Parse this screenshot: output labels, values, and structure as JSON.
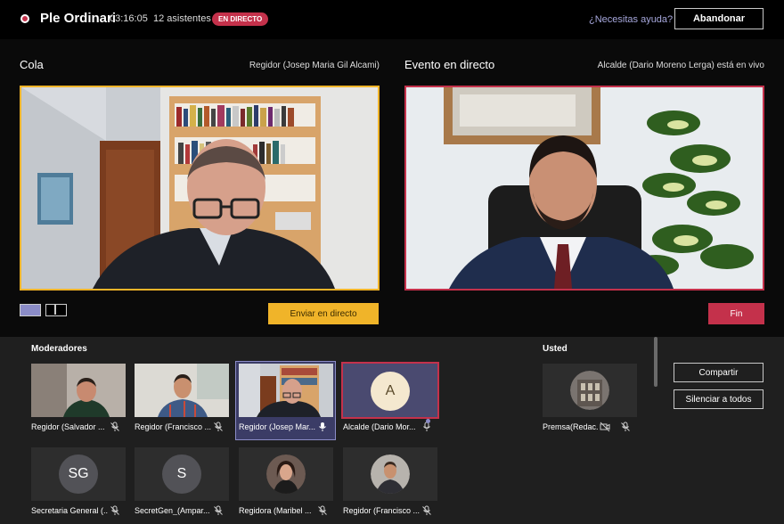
{
  "meeting": {
    "title": "Ple Ordinari",
    "duration": "03:16:05",
    "attendees": "12 asistentes",
    "live_badge": "EN DIRECTO",
    "help_link": "¿Necesitas ayuda?",
    "leave_label": "Abandonar"
  },
  "queue": {
    "heading": "Cola",
    "presenter": "Regidor (Josep Maria Gil Alcami)",
    "send_live_label": "Enviar en directo"
  },
  "live": {
    "heading": "Evento en directo",
    "status": "Alcalde (Dario Moreno Lerga) está en vivo",
    "end_label": "Fin"
  },
  "moderators": {
    "heading": "Moderadores",
    "tiles": [
      {
        "name": "Regidor (Salvador ..."
      },
      {
        "name": "Regidor (Francisco ..."
      },
      {
        "name": "Regidor (Josep Mar..."
      },
      {
        "name": "Alcalde (Dario Mor...",
        "initial": "A"
      }
    ],
    "row2": [
      {
        "name": "Secretaria General (...",
        "initials": "SG"
      },
      {
        "name": "SecretGen_(Ampar...",
        "initials": "S"
      },
      {
        "name": "Regidora (Maribel ..."
      },
      {
        "name": "Regidor (Francisco ..."
      }
    ]
  },
  "you": {
    "heading": "Usted",
    "name": "Premsa(Redac...",
    "share_label": "Compartir",
    "mute_all_label": "Silenciar a todos"
  },
  "colors": {
    "live_red": "#c4314b",
    "queue_yellow": "#f0b429",
    "accent_purple": "#8b8cc7"
  }
}
